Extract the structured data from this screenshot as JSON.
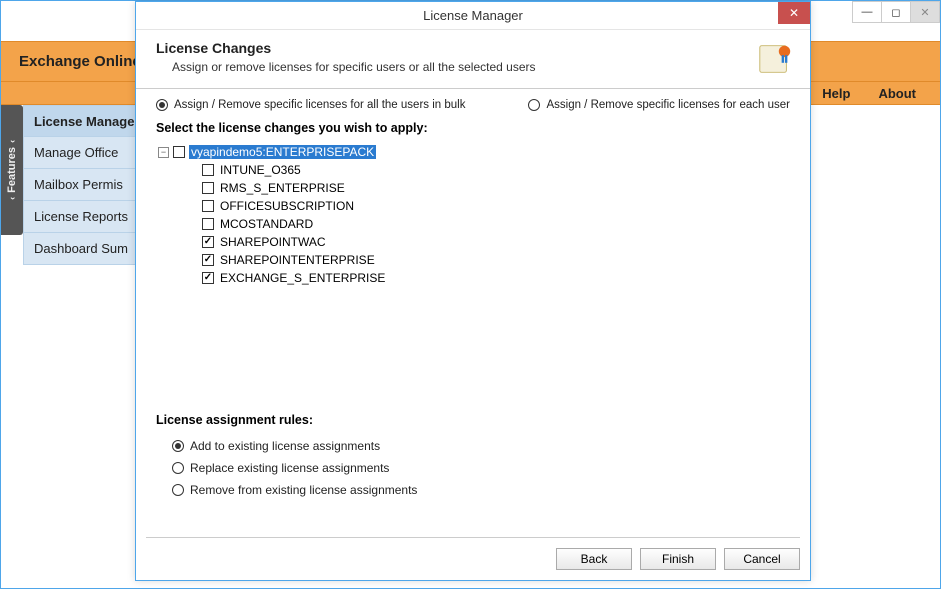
{
  "main_window": {
    "title": "Exchange Online R",
    "menu": {
      "help": "Help",
      "about": "About"
    },
    "features_tab": "Features",
    "nav": [
      "License Manage",
      "Manage Office",
      "Mailbox Permis",
      "License Reports",
      "Dashboard Sum"
    ]
  },
  "dialog": {
    "title": "License Manager",
    "header": {
      "heading": "License Changes",
      "subheading": "Assign or remove licenses for specific users or all the selected users"
    },
    "mode": {
      "bulk": "Assign / Remove specific licenses for all the users in bulk",
      "each": "Assign / Remove specific licenses for each user",
      "selected": "bulk"
    },
    "select_label": "Select the license changes you wish to apply:",
    "tree": {
      "root": {
        "label": "vyapindemo5:ENTERPRISEPACK",
        "checked": false,
        "selected": true,
        "expanded": true
      },
      "children": [
        {
          "label": "INTUNE_O365",
          "checked": false
        },
        {
          "label": "RMS_S_ENTERPRISE",
          "checked": false
        },
        {
          "label": "OFFICESUBSCRIPTION",
          "checked": false
        },
        {
          "label": "MCOSTANDARD",
          "checked": false
        },
        {
          "label": "SHAREPOINTWAC",
          "checked": true
        },
        {
          "label": "SHAREPOINTENTERPRISE",
          "checked": true
        },
        {
          "label": "EXCHANGE_S_ENTERPRISE",
          "checked": true
        }
      ]
    },
    "rules": {
      "heading": "License assignment rules:",
      "options": [
        "Add to existing license assignments",
        "Replace existing license assignments",
        "Remove from existing license assignments"
      ],
      "selected": 0
    },
    "buttons": {
      "back": "Back",
      "finish": "Finish",
      "cancel": "Cancel"
    }
  }
}
